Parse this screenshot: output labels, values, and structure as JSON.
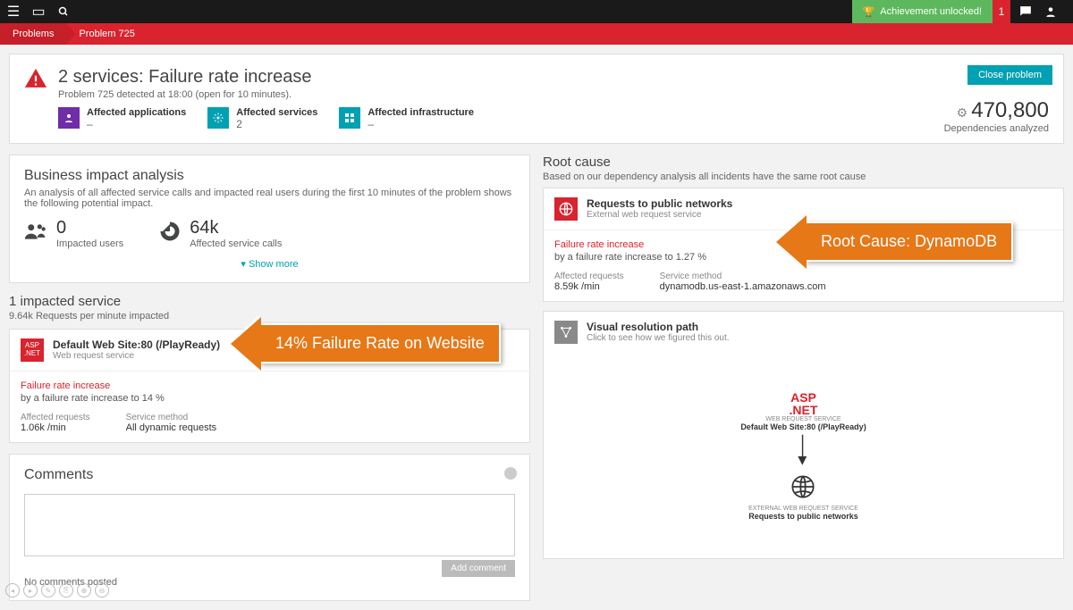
{
  "topbar": {
    "achievement": "Achievement unlocked!",
    "notif_count": "1"
  },
  "breadcrumb": {
    "root": "Problems",
    "current": "Problem 725"
  },
  "header": {
    "title": "2 services: Failure rate increase",
    "subtitle": "Problem 725 detected at 18:00 (open for 10 minutes).",
    "close": "Close problem",
    "stats": {
      "apps_label": "Affected applications",
      "apps_val": "–",
      "svc_label": "Affected services",
      "svc_val": "2",
      "infra_label": "Affected infrastructure",
      "infra_val": "–"
    },
    "deps": {
      "num": "470,800",
      "lbl": "Dependencies analyzed"
    }
  },
  "impact": {
    "title": "Business impact analysis",
    "desc": "An analysis of all affected service calls and impacted real users during the first 10 minutes of the problem shows the following potential impact.",
    "users_val": "0",
    "users_lbl": "Impacted users",
    "calls_val": "64k",
    "calls_lbl": "Affected service calls",
    "show_more": "Show more"
  },
  "impacted": {
    "title": "1 impacted service",
    "sub": "9.64k Requests per minute impacted",
    "svc_name": "Default Web Site:80 (/PlayReady)",
    "svc_type": "Web request service",
    "fail_title": "Failure rate increase",
    "fail_desc": "by a failure rate increase to 14 %",
    "req_lbl": "Affected requests",
    "req_val": "1.06k /min",
    "method_lbl": "Service method",
    "method_val": "All dynamic requests",
    "badge": "ASP .NET"
  },
  "root": {
    "title": "Root cause",
    "sub": "Based on our dependency analysis all incidents have the same root cause",
    "svc_name": "Requests to public networks",
    "svc_type": "External web request service",
    "fail_title": "Failure rate increase",
    "fail_desc": "by a failure rate increase to 1.27 %",
    "req_lbl": "Affected requests",
    "req_val": "8.59k /min",
    "method_lbl": "Service method",
    "method_val": "dynamodb.us-east-1.amazonaws.com"
  },
  "vis": {
    "title": "Visual resolution path",
    "sub": "Click to see how we figured this out.",
    "node1_type": "WEB REQUEST SERVICE",
    "node1_name": "Default Web Site:80 (/PlayReady)",
    "node2_type": "EXTERNAL WEB REQUEST SERVICE",
    "node2_name": "Requests to public networks",
    "asp1": "ASP",
    "asp2": ".NET"
  },
  "comments": {
    "title": "Comments",
    "add_btn": "Add comment",
    "empty": "No comments posted"
  },
  "annotations": {
    "left": "14% Failure Rate on Website",
    "right": "Root Cause: DynamoDB"
  }
}
